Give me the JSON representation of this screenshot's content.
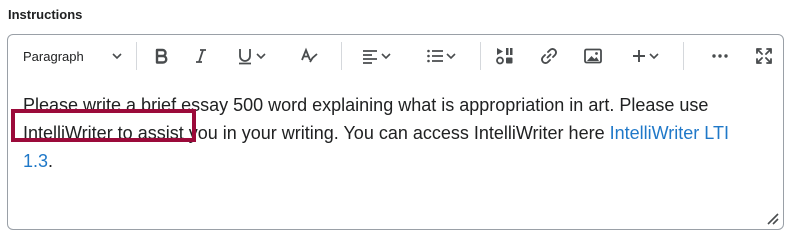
{
  "field": {
    "label": "Instructions"
  },
  "toolbar": {
    "paragraph_label": "Paragraph",
    "icons": [
      "chevron-down-icon",
      "bold-icon",
      "italic-icon",
      "underline-icon",
      "format-clear-icon",
      "align-icon",
      "list-icon",
      "media-icon",
      "link-icon",
      "image-icon",
      "plus-icon",
      "more-icon",
      "fullscreen-icon"
    ]
  },
  "content": {
    "text_before_link": "Please write a brief essay 500 word explaining what is appropriation in art. Please use IntelliWriter to assist you in your writing. You can access IntelliWriter here ",
    "link_text": "IntelliWriter LTI 1.3",
    "text_after_link": "."
  },
  "colors": {
    "link": "#1f78c8",
    "highlight_border": "#9b0a3a",
    "border": "#9aa0a7"
  }
}
